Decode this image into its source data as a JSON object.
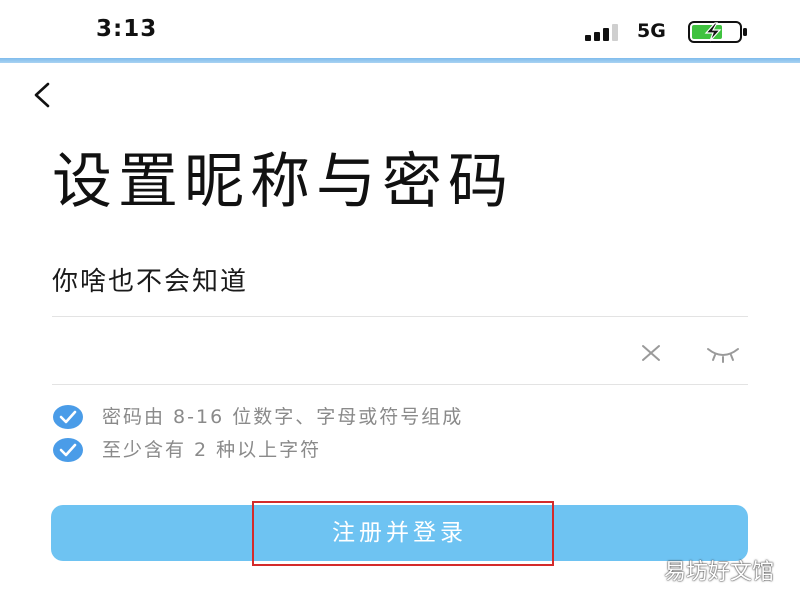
{
  "status_bar": {
    "time": "3:13",
    "network": "5G",
    "icons": [
      "signal-icon",
      "battery-charging-icon"
    ]
  },
  "nav": {
    "back_icon": "chevron-left-icon"
  },
  "title": "设置昵称与密码",
  "nickname": {
    "value": "你啥也不会知道"
  },
  "password": {
    "value": "",
    "clear_icon": "close-icon",
    "visibility_icon": "eye-closed-icon"
  },
  "rules": [
    {
      "text": "密码由 8-16 位数字、字母或符号组成",
      "checked": true
    },
    {
      "text": "至少含有 2 种以上字符",
      "checked": true
    }
  ],
  "register_button": {
    "label": "注册并登录"
  },
  "watermark": "易坊好文馆",
  "colors": {
    "accent": "#6ec3f2",
    "check": "#4a9ce8",
    "highlight": "#d42b2b",
    "rule_text": "#8a8a8a"
  }
}
